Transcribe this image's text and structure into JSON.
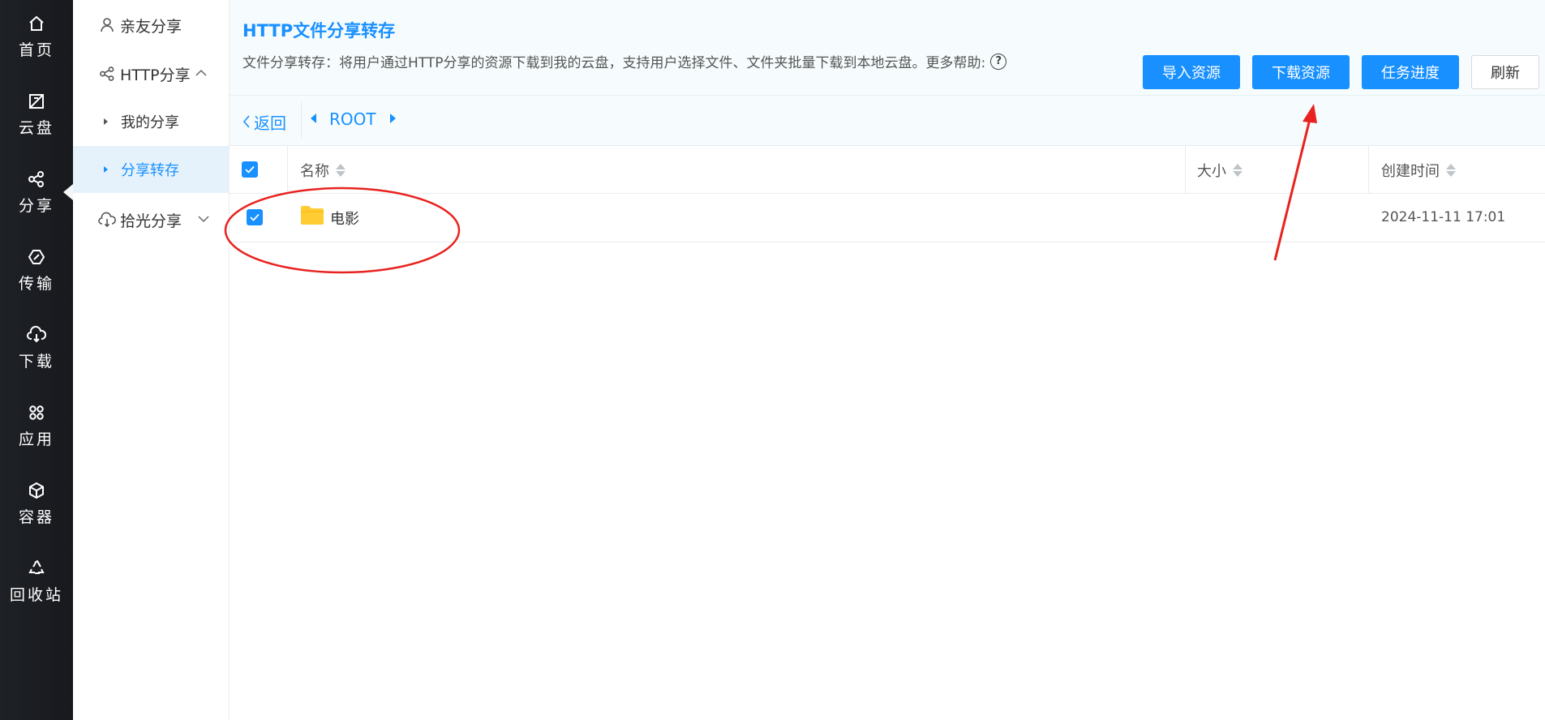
{
  "rail": {
    "items": [
      {
        "label": "首页",
        "icon": "home-icon"
      },
      {
        "label": "云盘",
        "icon": "cloud-disk-icon"
      },
      {
        "label": "分享",
        "icon": "share-icon"
      },
      {
        "label": "传输",
        "icon": "transfer-icon"
      },
      {
        "label": "下载",
        "icon": "download-icon"
      },
      {
        "label": "应用",
        "icon": "apps-icon"
      },
      {
        "label": "容器",
        "icon": "container-icon"
      },
      {
        "label": "回收站",
        "icon": "recycle-icon"
      }
    ],
    "active": "分享"
  },
  "sidebar": {
    "friend_share": "亲友分享",
    "http_share": "HTTP分享",
    "my_share": "我的分享",
    "share_transfer": "分享转存",
    "shiguang_share": "拾光分享"
  },
  "header": {
    "title": "HTTP文件分享转存",
    "description": "文件分享转存：将用户通过HTTP分享的资源下载到我的云盘，支持用户选择文件、文件夹批量下载到本地云盘。更多帮助:",
    "help_glyph": "?"
  },
  "toolbar": {
    "import_label": "导入资源",
    "download_label": "下载资源",
    "progress_label": "任务进度",
    "refresh_label": "刷新"
  },
  "breadcrumb": {
    "back_label": "返回",
    "root_label": "ROOT"
  },
  "table": {
    "columns": {
      "name": "名称",
      "size": "大小",
      "created": "创建时间"
    },
    "rows": [
      {
        "name": "电影",
        "size": "",
        "created": "2024-11-11 17:01",
        "type": "folder",
        "selected": true
      }
    ],
    "header_checked": true
  },
  "colors": {
    "accent": "#1890ff",
    "rail_bg": "#1e2126",
    "folder": "#ffcc33",
    "annotation": "#e8231f"
  }
}
